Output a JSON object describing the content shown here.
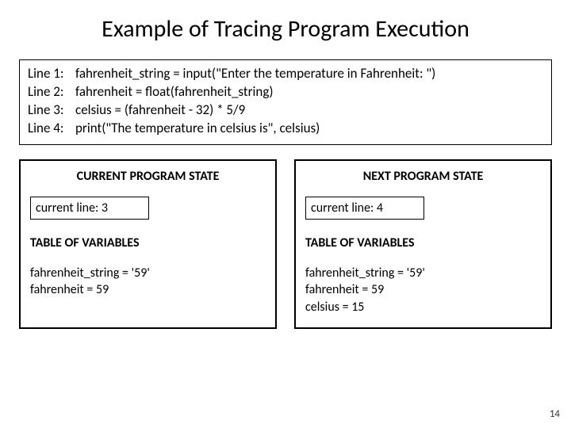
{
  "title": "Example of Tracing Program Execution",
  "code": {
    "l1_label": "Line 1:",
    "l1_text": "fahrenheit_string = input(\"Enter the temperature in Fahrenheit: \")",
    "l2_label": "Line 2:",
    "l2_text": "fahrenheit = float(fahrenheit_string)",
    "l3_label": "Line 3:",
    "l3_text": "celsius = (fahrenheit - 32) * 5/9",
    "l4_label": "Line 4:",
    "l4_text": "print(\"The temperature in celsius is\", celsius)"
  },
  "current_state": {
    "title": "CURRENT PROGRAM STATE",
    "current_line": "current line: 3",
    "table_title": "TABLE OF VARIABLES",
    "var1": "fahrenheit_string = '59'",
    "var2": "fahrenheit = 59"
  },
  "next_state": {
    "title": "NEXT PROGRAM STATE",
    "current_line": "current line: 4",
    "table_title": "TABLE OF VARIABLES",
    "var1": "fahrenheit_string = '59'",
    "var2": "fahrenheit = 59",
    "var3": "celsius = 15"
  },
  "page_number": "14"
}
